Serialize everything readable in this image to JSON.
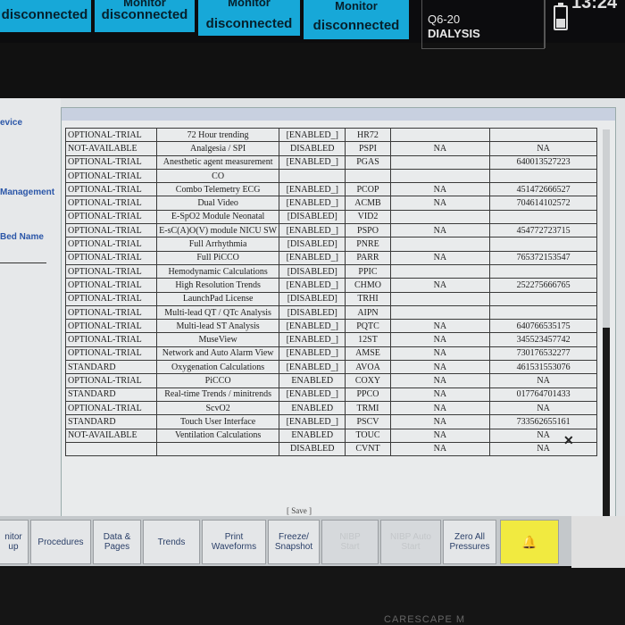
{
  "top_bar": {
    "tiles": [
      {
        "line1": "",
        "line2": "disconnected"
      },
      {
        "line1": "Monitor",
        "line2": "disconnected"
      },
      {
        "line1": "Monitor",
        "line2": "disconnected"
      },
      {
        "line1": "Monitor",
        "line2": "disconnected"
      }
    ],
    "unit_bed": "Q6-20",
    "unit_name": "DIALYSIS",
    "clock": "13:24",
    "battery_icon": "battery-icon"
  },
  "left_panel": {
    "labels": [
      "evice",
      "Management",
      "Bed Name"
    ]
  },
  "options_table": {
    "rows": [
      [
        "OPTIONAL-TRIAL",
        "72 Hour trending",
        "[ENABLED_]",
        "HR72",
        "",
        ""
      ],
      [
        "NOT-AVAILABLE",
        "Analgesia / SPI",
        "DISABLED",
        "PSPI",
        "NA",
        "NA"
      ],
      [
        "OPTIONAL-TRIAL",
        "Anesthetic agent measurement",
        "[ENABLED_]",
        "PGAS",
        "",
        "640013527223"
      ],
      [
        "OPTIONAL-TRIAL",
        "CO",
        "",
        "",
        "",
        ""
      ],
      [
        "OPTIONAL-TRIAL",
        "Combo Telemetry ECG",
        "[ENABLED_]",
        "PCOP",
        "NA",
        "451472666527"
      ],
      [
        "OPTIONAL-TRIAL",
        "Dual Video",
        "[ENABLED_]",
        "ACMB",
        "NA",
        "704614102572"
      ],
      [
        "OPTIONAL-TRIAL",
        "E-SpO2 Module Neonatal",
        "[DISABLED]",
        "VID2",
        "",
        ""
      ],
      [
        "OPTIONAL-TRIAL",
        "E-sC(A)O(V) module NICU SW",
        "[ENABLED_]",
        "PSPO",
        "NA",
        "454772723715"
      ],
      [
        "OPTIONAL-TRIAL",
        "Full Arrhythmia",
        "[DISABLED]",
        "PNRE",
        "",
        ""
      ],
      [
        "OPTIONAL-TRIAL",
        "Full PiCCO",
        "[ENABLED_]",
        "PARR",
        "NA",
        "765372153547"
      ],
      [
        "OPTIONAL-TRIAL",
        "Hemodynamic Calculations",
        "[DISABLED]",
        "PPIC",
        "",
        ""
      ],
      [
        "OPTIONAL-TRIAL",
        "High Resolution Trends",
        "[ENABLED_]",
        "CHMO",
        "NA",
        "252275666765"
      ],
      [
        "OPTIONAL-TRIAL",
        "LaunchPad License",
        "[DISABLED]",
        "TRHI",
        "",
        ""
      ],
      [
        "OPTIONAL-TRIAL",
        "Multi-lead QT / QTc Analysis",
        "[DISABLED]",
        "AIPN",
        "",
        ""
      ],
      [
        "OPTIONAL-TRIAL",
        "Multi-lead ST Analysis",
        "[ENABLED_]",
        "PQTC",
        "NA",
        "640766535175"
      ],
      [
        "OPTIONAL-TRIAL",
        "MuseView",
        "[ENABLED_]",
        "12ST",
        "NA",
        "345523457742"
      ],
      [
        "OPTIONAL-TRIAL",
        "Network and Auto Alarm View",
        "[ENABLED_]",
        "AMSE",
        "NA",
        "730176532277"
      ],
      [
        "STANDARD",
        "Oxygenation Calculations",
        "[ENABLED_]",
        "AVOA",
        "NA",
        "461531553076"
      ],
      [
        "OPTIONAL-TRIAL",
        "PiCCO",
        "ENABLED",
        "COXY",
        "NA",
        "NA"
      ],
      [
        "STANDARD",
        "Real-time Trends / minitrends",
        "[ENABLED_]",
        "PPCO",
        "NA",
        "017764701433"
      ],
      [
        "OPTIONAL-TRIAL",
        "ScvO2",
        "ENABLED",
        "TRMI",
        "NA",
        "NA"
      ],
      [
        "STANDARD",
        "Touch User Interface",
        "[ENABLED_]",
        "PSCV",
        "NA",
        "733562655161"
      ],
      [
        "NOT-AVAILABLE",
        "Ventilation Calculations",
        "ENABLED",
        "TOUC",
        "NA",
        "NA"
      ],
      [
        "",
        "",
        "DISABLED",
        "CVNT",
        "NA",
        "NA"
      ]
    ],
    "save_label": "[ Save ]",
    "close_icon": "x-icon"
  },
  "bottom_buttons": [
    {
      "label": "nitor\nup",
      "state": "active"
    },
    {
      "label": "Procedures",
      "state": "active"
    },
    {
      "label": "Data &\nPages",
      "state": "active"
    },
    {
      "label": "Trends",
      "state": "active"
    },
    {
      "label": "Print\nWaveforms",
      "state": "active"
    },
    {
      "label": "Freeze/\nSnapshot",
      "state": "active"
    },
    {
      "label": "NIBP\nStart",
      "state": "disabled"
    },
    {
      "label": "NIBP Auto\nStart",
      "state": "disabled"
    },
    {
      "label": "Zero All\nPressures",
      "state": "active"
    },
    {
      "label": "",
      "state": "alarm"
    }
  ],
  "brand": "CARESCAPE M"
}
